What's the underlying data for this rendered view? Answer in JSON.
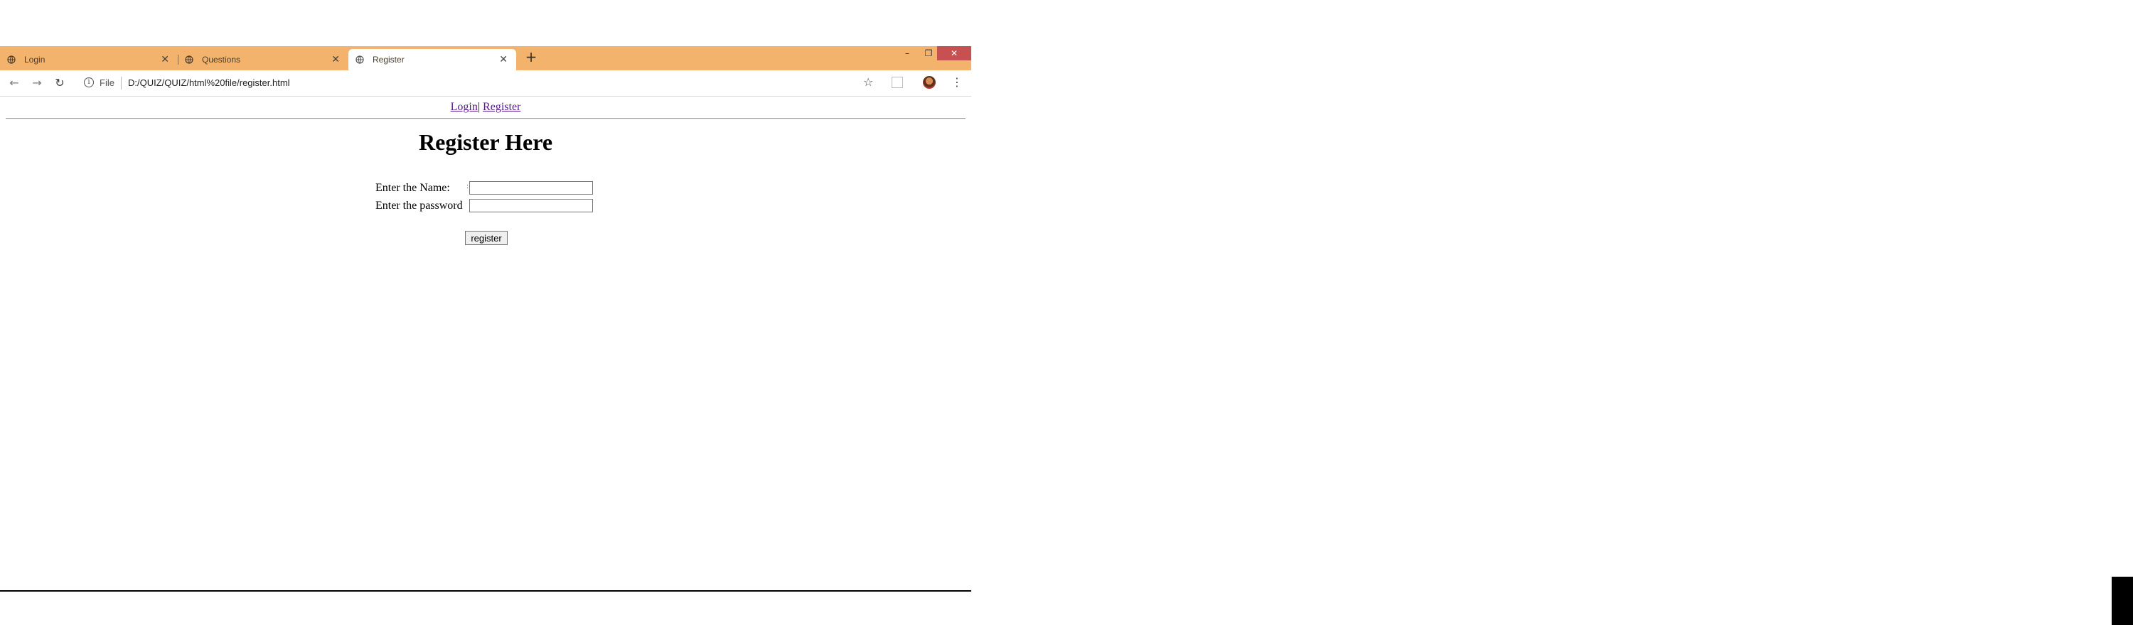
{
  "browser": {
    "tabs": [
      {
        "title": "Login"
      },
      {
        "title": "Questions"
      },
      {
        "title": "Register"
      }
    ],
    "new_tab_symbol": "+",
    "window_controls": {
      "minimize": "–",
      "restore": "❐",
      "close": "✕"
    },
    "address": {
      "scheme_label": "File",
      "url": "D:/QUIZ/QUIZ/html%20file/register.html"
    }
  },
  "page": {
    "nav": {
      "login": "Login",
      "separator": "|",
      "register": "Register"
    },
    "heading": "Register Here",
    "form": {
      "name_label": "Enter the Name:",
      "password_label": "Enter the password",
      "colon": ":",
      "name_value": "",
      "password_value": "",
      "submit_label": "register"
    }
  },
  "colors": {
    "tabstrip": "#f4b36c",
    "close_button": "#c75050",
    "visited_link": "#551a8b"
  }
}
